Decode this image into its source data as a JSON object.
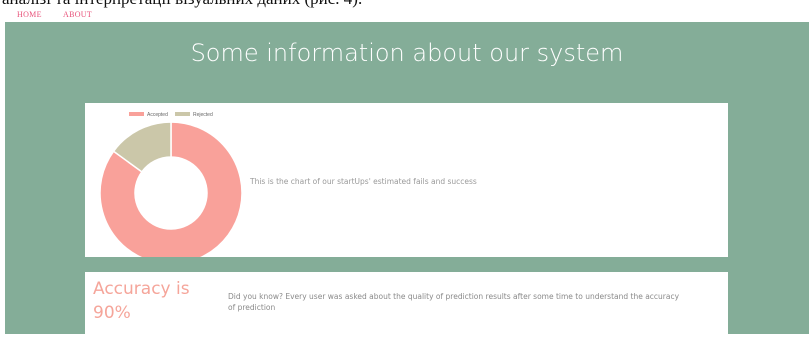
{
  "top_cut_text": "аналізі та інтерпретації візуальних даних (рис. 4).",
  "nav": {
    "home": "HOME",
    "about": "ABOUT"
  },
  "page_title": "Some information about our system",
  "chart_section": {
    "description": "This is the chart of our startUps' estimated fails and success"
  },
  "chart_data": {
    "type": "pie",
    "variant": "doughnut",
    "title": "",
    "legend_position": "top",
    "categories": [
      "Accepted",
      "Rejected"
    ],
    "values": [
      85,
      15
    ],
    "colors": [
      "#f9a19a",
      "#cbc7a9"
    ]
  },
  "accuracy": {
    "title": "Accuracy is 90%",
    "text": "Did you know? Every user was asked about the quality of prediction results after some time to understand the accuracy of prediction"
  },
  "colors": {
    "background": "#84ad98",
    "card": "#ffffff",
    "nav_link": "#e8527a",
    "accent": "#f5a59a"
  }
}
